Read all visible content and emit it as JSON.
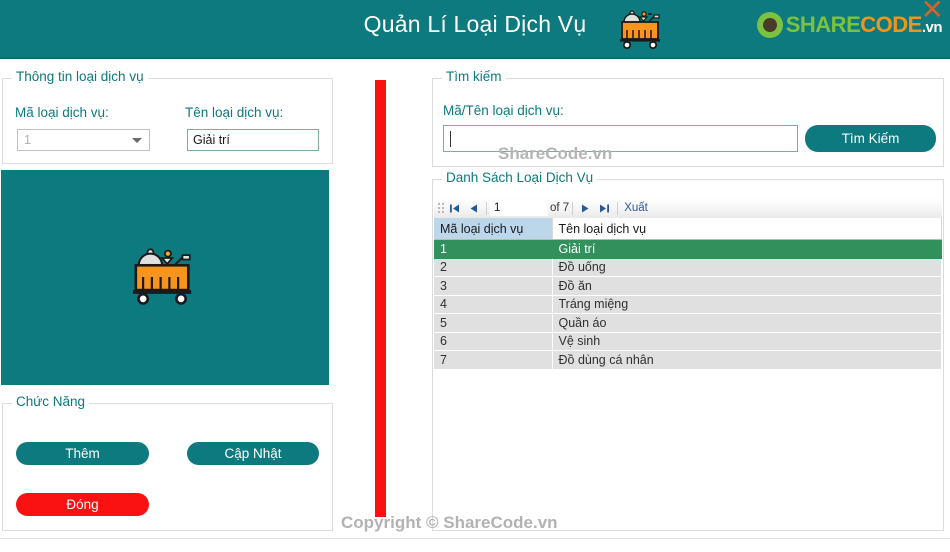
{
  "window": {
    "title": "Quản Lí Loại Dịch Vụ",
    "close_label": "✕"
  },
  "brand": {
    "share": "SHARE",
    "code": "CODE",
    "tld": ".vn",
    "logo_icon": "recycle-logo-icon",
    "header_icon": "room-service-cart-icon"
  },
  "info_panel": {
    "legend": "Thông tin loại dịch vụ",
    "code_label": "Mã loại dịch vụ:",
    "code_value": "1",
    "name_label": "Tên loại dịch vụ:",
    "name_value": "Giải trí",
    "name_placeholder": ""
  },
  "image_panel": {
    "icon": "room-service-cart-icon",
    "background": "#0c7a7e"
  },
  "functions_panel": {
    "legend": "Chức Năng",
    "add_label": "Thêm",
    "update_label": "Cập Nhật",
    "close_label": "Đóng"
  },
  "search_panel": {
    "legend": "Tìm kiếm",
    "field_label": "Mã/Tên loại dịch vụ:",
    "input_value": "",
    "input_placeholder": "",
    "button_label": "Tìm Kiếm"
  },
  "list_panel": {
    "legend": "Danh Sách Loại Dịch Vụ",
    "toolbar": {
      "first_icon": "first-page-icon",
      "prev_icon": "previous-page-icon",
      "page_value": "1",
      "of_text": "of 7",
      "next_icon": "next-page-icon",
      "last_icon": "last-page-icon",
      "export_label": "Xuất"
    },
    "columns": [
      "Mã loại dịch vụ",
      "Tên loại dịch vụ"
    ],
    "rows": [
      {
        "code": "1",
        "name": "Giải trí",
        "selected": true
      },
      {
        "code": "2",
        "name": "Đồ uống",
        "selected": false
      },
      {
        "code": "3",
        "name": "Đồ ăn",
        "selected": false
      },
      {
        "code": "4",
        "name": "Tráng miệng",
        "selected": false
      },
      {
        "code": "5",
        "name": "Quần áo",
        "selected": false
      },
      {
        "code": "6",
        "name": "Vệ sinh",
        "selected": false
      },
      {
        "code": "7",
        "name": "Đồ dùng cá nhân",
        "selected": false
      }
    ]
  },
  "watermarks": {
    "search_overlay": "ShareCode.vn",
    "bottom": "Copyright © ShareCode.vn"
  },
  "colors": {
    "teal": "#0c7a7e",
    "red": "#fa1111",
    "selection_green": "#31905c",
    "header_selected_blue": "#bcd6ea",
    "row_grey": "#e0e0e0",
    "brand_green": "#7cc142",
    "brand_orange": "#f0941e"
  }
}
